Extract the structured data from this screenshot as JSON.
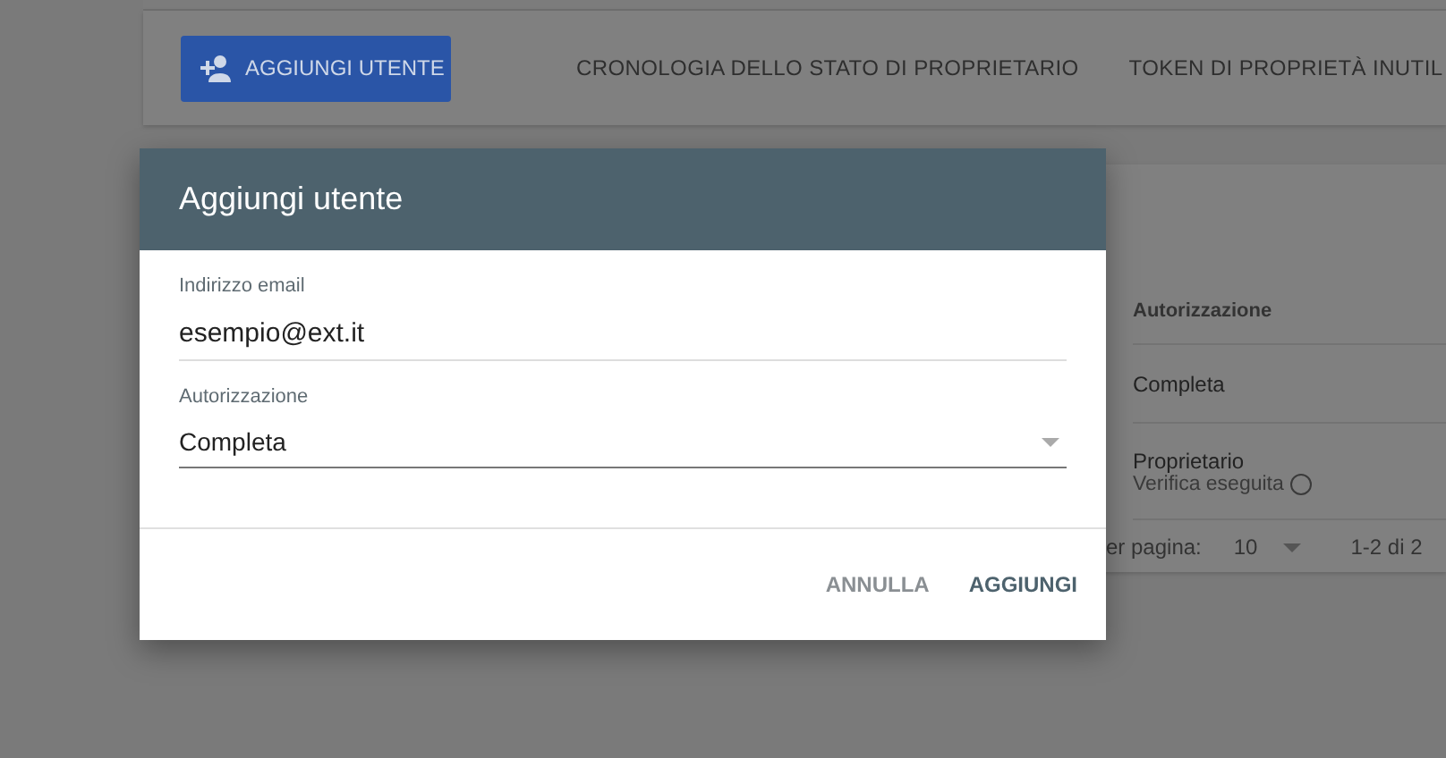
{
  "toolbar": {
    "add_button": {
      "label": "AGGIUNGI UTENTE"
    },
    "links": [
      {
        "label": "CRONOLOGIA DELLO STATO DI PROPRIETARIO"
      },
      {
        "label": "TOKEN DI PROPRIETÀ INUTIL"
      }
    ]
  },
  "table": {
    "columns": [
      "Autorizzazione"
    ],
    "rows": [
      {
        "text": "Completa"
      },
      {
        "text": "Proprietario",
        "subtext": "Verifica eseguita"
      }
    ],
    "pagination": {
      "rows_label": "er pagina:",
      "page_size": "10",
      "range": "1-2 di 2"
    }
  },
  "dialog": {
    "title": "Aggiungi utente",
    "fields": [
      {
        "kind": "text",
        "label": "Indirizzo email",
        "value": "esempio@ext.it"
      },
      {
        "kind": "select",
        "label": "Autorizzazione",
        "value": "Completa"
      }
    ],
    "buttons": [
      {
        "kind": "secondary",
        "label": "ANNULLA"
      },
      {
        "kind": "primary",
        "label": "AGGIUNGI"
      }
    ]
  }
}
